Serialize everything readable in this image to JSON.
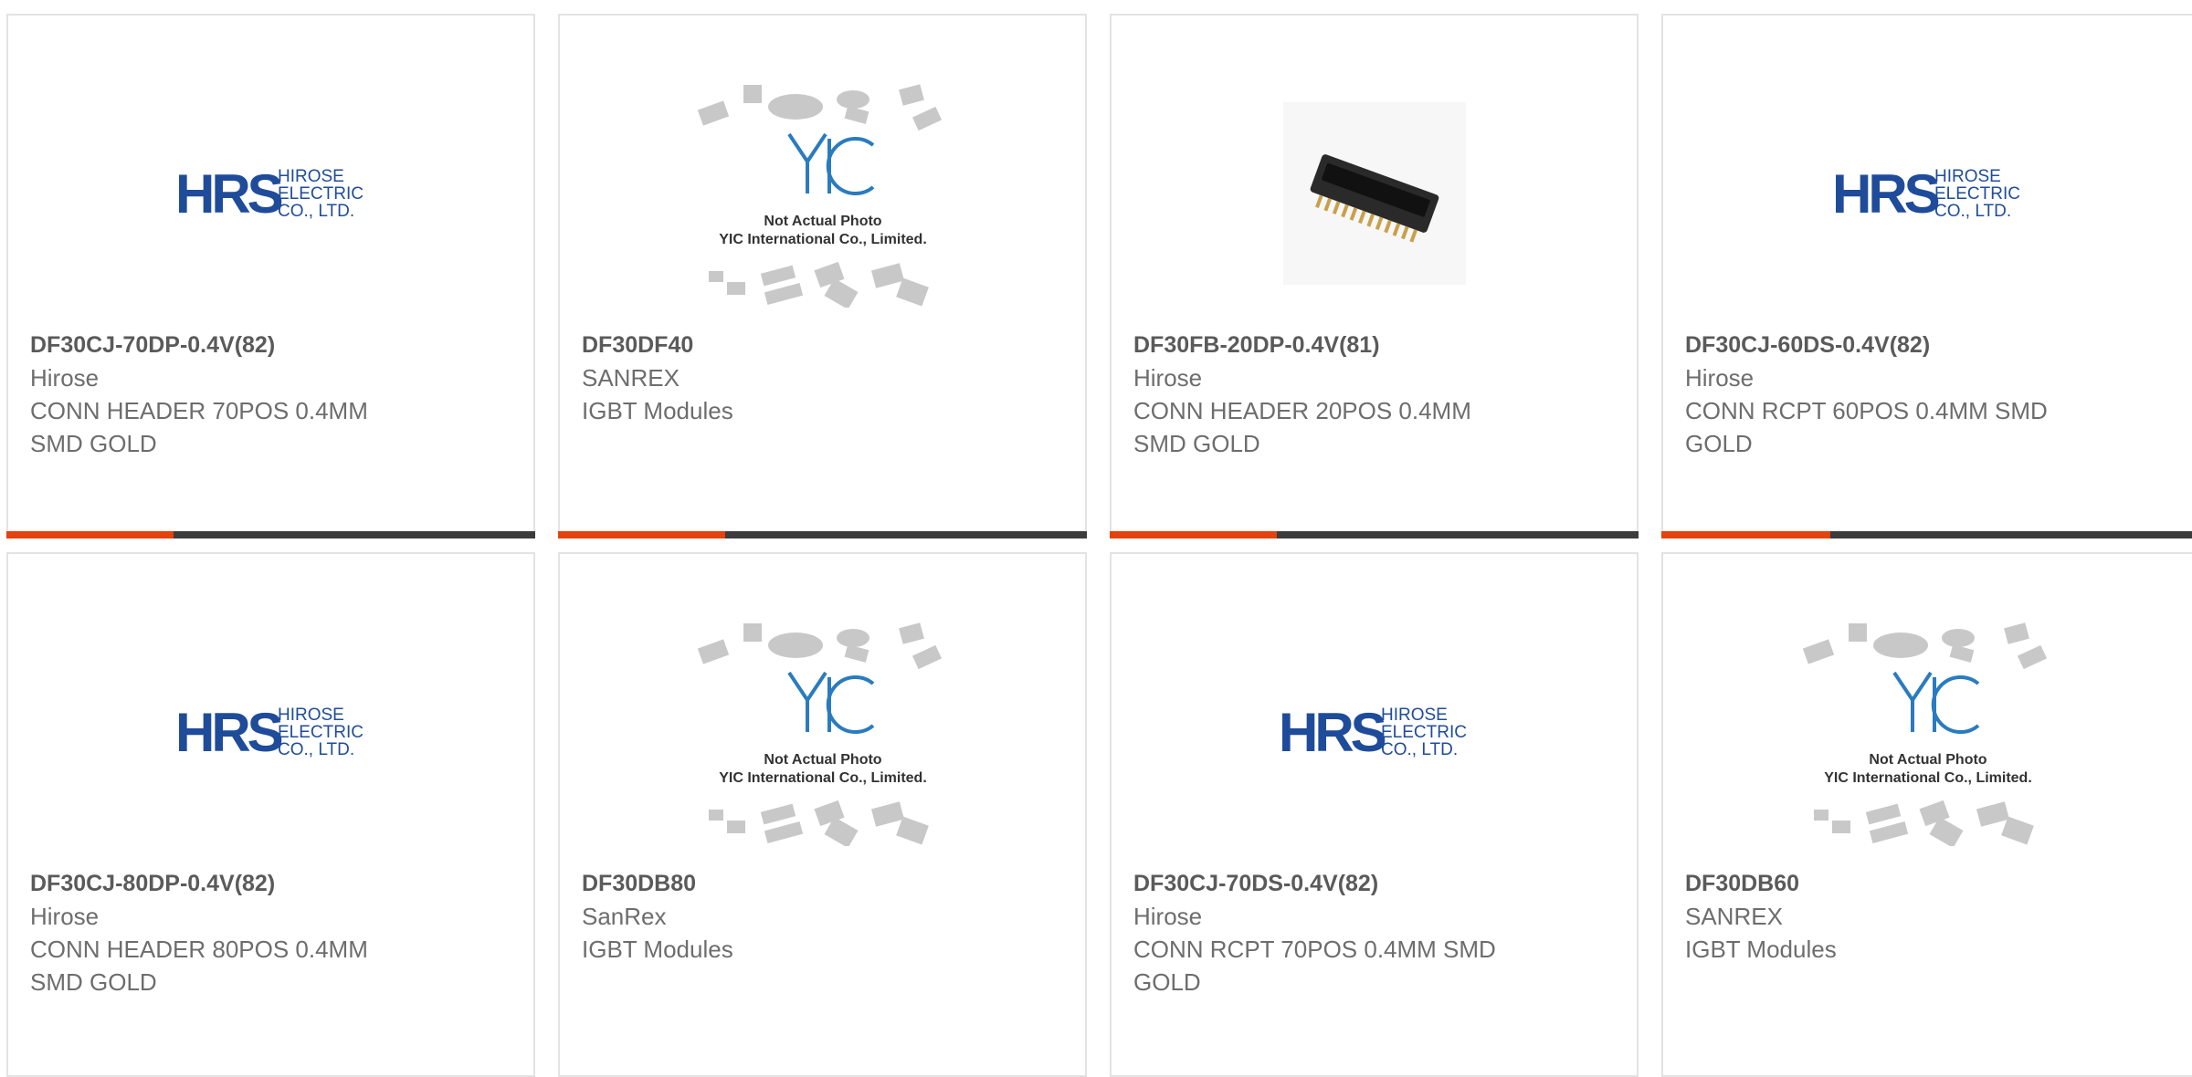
{
  "colors": {
    "accent": "#e4420e",
    "track": "#3c3c3c",
    "hrs_blue": "#1f4c9a",
    "text": "#6d6d6d"
  },
  "products": [
    {
      "image": "hrs-logo",
      "part_number": "DF30CJ-70DP-0.4V(82)",
      "brand": "Hirose",
      "description": "CONN HEADER 70POS 0.4MM SMD GOLD",
      "progress": 0.316
    },
    {
      "image": "yic-placeholder",
      "part_number": "DF30DF40",
      "brand": "SANREX",
      "description": "IGBT Modules",
      "progress": 0.316
    },
    {
      "image": "connector-photo",
      "part_number": "DF30FB-20DP-0.4V(81)",
      "brand": "Hirose",
      "description": "CONN HEADER 20POS 0.4MM SMD GOLD",
      "progress": 0.316
    },
    {
      "image": "hrs-logo",
      "part_number": "DF30CJ-60DS-0.4V(82)",
      "brand": "Hirose",
      "description": "CONN RCPT 60POS 0.4MM SMD GOLD",
      "progress": 0.316
    },
    {
      "image": "hrs-logo",
      "part_number": "DF30CJ-80DP-0.4V(82)",
      "brand": "Hirose",
      "description": "CONN HEADER 80POS 0.4MM SMD GOLD"
    },
    {
      "image": "yic-placeholder",
      "part_number": "DF30DB80",
      "brand": "SanRex",
      "description": "IGBT Modules"
    },
    {
      "image": "hrs-logo",
      "part_number": "DF30CJ-70DS-0.4V(82)",
      "brand": "Hirose",
      "description": "CONN RCPT 70POS 0.4MM SMD GOLD"
    },
    {
      "image": "yic-placeholder",
      "part_number": "DF30DB60",
      "brand": "SANREX",
      "description": "IGBT Modules"
    }
  ],
  "logos": {
    "hrs_mark": "HRS",
    "hrs_line1": "HIROSE",
    "hrs_line2": "ELECTRIC",
    "hrs_line3": "CO., LTD.",
    "yic_mark": "YIC",
    "yic_line1": "Not Actual Photo",
    "yic_line2": "YIC International Co., Limited."
  }
}
